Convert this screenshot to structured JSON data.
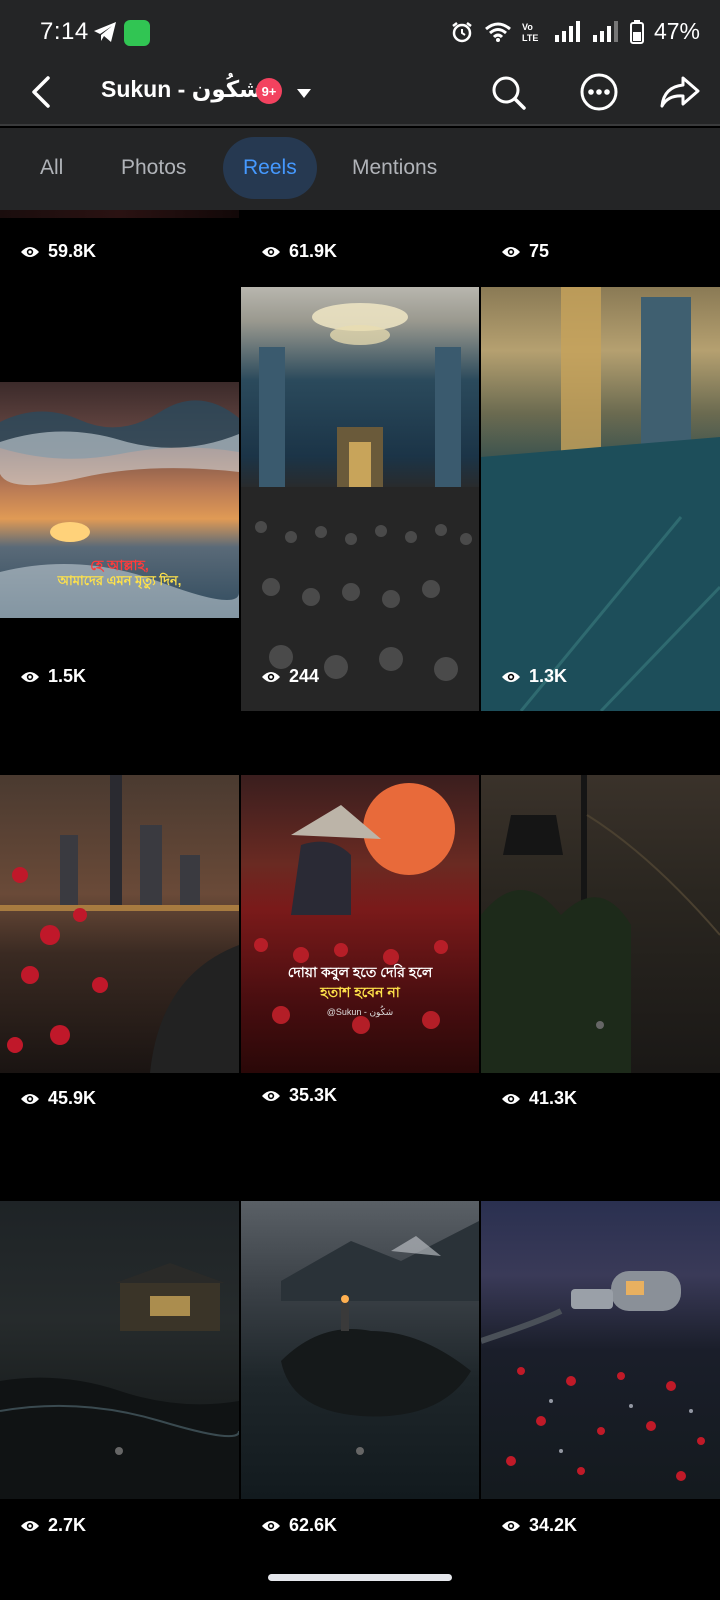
{
  "status": {
    "time": "7:14",
    "battery": "47%"
  },
  "header": {
    "title": "Sukun - شكُون",
    "badge": "9+",
    "back_icon": "back-arrow-icon",
    "search_icon": "search-icon",
    "more_icon": "more-icon",
    "share_icon": "share-icon"
  },
  "tabs": [
    {
      "label": "All",
      "active": false
    },
    {
      "label": "Photos",
      "active": false
    },
    {
      "label": "Reels",
      "active": true
    },
    {
      "label": "Mentions",
      "active": false
    }
  ],
  "reels": [
    {
      "views": "59.8K"
    },
    {
      "views": "61.9K"
    },
    {
      "views": "75"
    },
    {
      "views": "1.5K",
      "caption_1": "হে আল্লাহ,",
      "caption_2": "আমাদের এমন মৃত্যু দিন,"
    },
    {
      "views": "244"
    },
    {
      "views": "1.3K"
    },
    {
      "views": "45.9K"
    },
    {
      "views": "35.3K",
      "caption_1": "দোয়া কবুল হতে দেরি হলে",
      "caption_2": "হতাশ হবেন না",
      "handle": "@Sukun - شكُون"
    },
    {
      "views": "41.3K"
    },
    {
      "views": "2.7K"
    },
    {
      "views": "62.6K"
    },
    {
      "views": "34.2K"
    }
  ],
  "colors": {
    "surface": "#242526",
    "accent": "#4599ff",
    "accent_bg": "#263951",
    "badge": "#f3425f"
  }
}
